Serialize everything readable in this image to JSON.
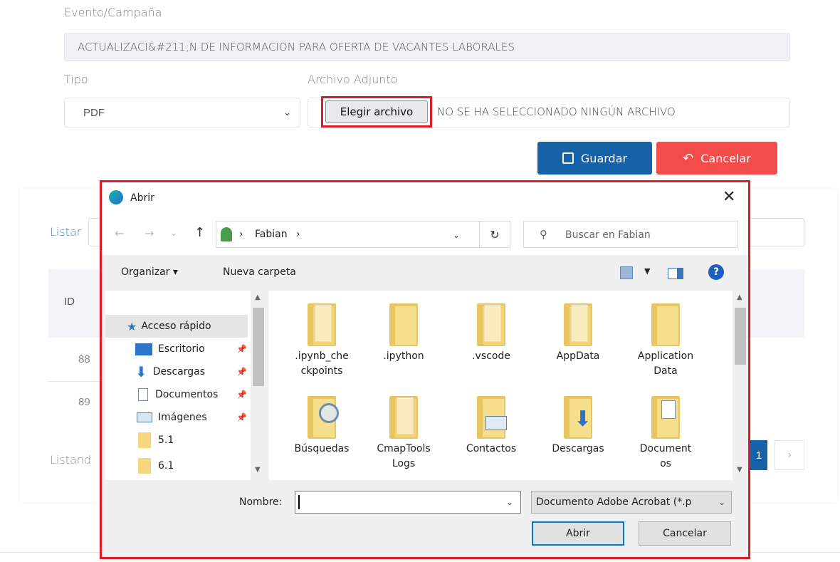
{
  "form": {
    "evento_label": "Evento/Campaña",
    "evento_value": "ACTUALIZACI&#211;N DE INFORMACION PARA OFERTA DE VACANTES LABORALES",
    "tipo_label": "Tipo",
    "tipo_value": "PDF",
    "archivo_label": "Archivo Adjunto",
    "choose_file_label": "Elegir archivo",
    "no_file_text": "NO SE HA SELECCIONADO NINGÚN ARCHIVO",
    "save_label": "Guardar",
    "cancel_label": "Cancelar",
    "save_color": "#1562a8",
    "cancel_color": "#f44b4b"
  },
  "background_list": {
    "listar_label": "Listar",
    "id_header": "ID",
    "rows": [
      "88",
      "89"
    ],
    "footer_label": "Listand",
    "current_page": "1"
  },
  "dialog": {
    "title": "Abrir",
    "breadcrumb": [
      "Fabian"
    ],
    "search_placeholder": "Buscar en Fabian",
    "organize_label": "Organizar ▾",
    "new_folder_label": "Nueva carpeta",
    "nav_items": [
      {
        "label": "Acceso rápido",
        "icon": "star-icon"
      },
      {
        "label": "Escritorio",
        "icon": "desktop-icon"
      },
      {
        "label": "Descargas",
        "icon": "download-icon"
      },
      {
        "label": "Documentos",
        "icon": "documents-icon"
      },
      {
        "label": "Imágenes",
        "icon": "pictures-icon"
      },
      {
        "label": "5.1",
        "icon": "folder-icon"
      },
      {
        "label": "6.1",
        "icon": "folder-icon"
      }
    ],
    "files": [
      {
        "label": ".ipynb_che\nckpoints",
        "kind": "plain"
      },
      {
        "label": ".ipython",
        "kind": "zip"
      },
      {
        "label": ".vscode",
        "kind": "plain"
      },
      {
        "label": "AppData",
        "kind": "plain"
      },
      {
        "label": "Application\nData",
        "kind": "zip"
      },
      {
        "label": "Búsquedas",
        "kind": "search"
      },
      {
        "label": "CmapTools\nLogs",
        "kind": "plain"
      },
      {
        "label": "Contactos",
        "kind": "contacts"
      },
      {
        "label": "Descargas",
        "kind": "download"
      },
      {
        "label": "Document\nos",
        "kind": "doc"
      }
    ],
    "name_label": "Nombre:",
    "name_value": "",
    "filter_value": "Documento Adobe Acrobat (*.p",
    "open_label": "Abrir",
    "cancel_label": "Cancelar"
  }
}
